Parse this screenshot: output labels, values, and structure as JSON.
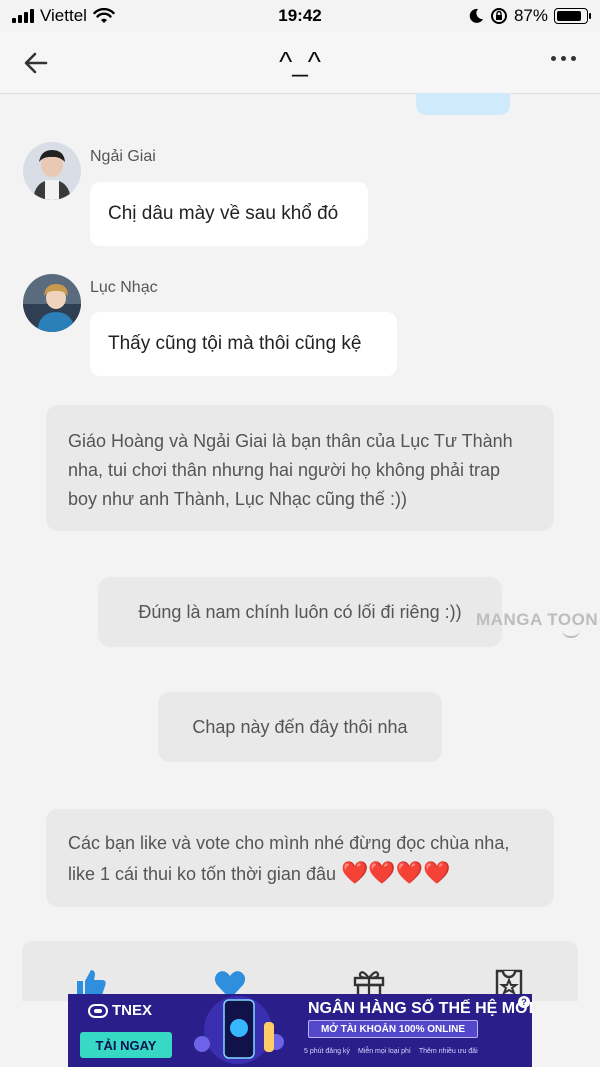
{
  "status_bar": {
    "carrier": "Viettel",
    "time": "19:42",
    "battery": "87%",
    "battery_level": 0.87
  },
  "nav": {
    "title": "^_^",
    "back_icon": "arrow-left-icon",
    "more_icon": "more-dots-icon"
  },
  "messages": [
    {
      "sender": "Ngải Giai",
      "text": "Chị dâu mày về sau khổ đó"
    },
    {
      "sender": "Lục Nhạc",
      "text": "Thấy cũng tội mà thôi cũng kệ"
    }
  ],
  "notes": [
    {
      "text": "Giáo Hoàng và Ngải Giai là bạn thân của Lục Tư Thành nha, tui chơi thân nhưng hai người họ không phải trap boy như anh Thành, Lục Nhạc cũng thế :))"
    },
    {
      "text": "Đúng là nam chính luôn có lối đi riêng :))"
    },
    {
      "text": "Chap này đến đây thôi nha"
    },
    {
      "text": "Các bạn like và vote cho mình nhé đừng đọc chùa nha, like 1 cái thui ko tốn thời gian đâu",
      "hearts": "❤️❤️❤️❤️"
    }
  ],
  "watermark": "MANGA TOON",
  "actions": [
    "like-icon",
    "heart-icon",
    "gift-icon",
    "ticket-star-icon"
  ],
  "ad": {
    "brand": "TNEX",
    "cta": "TẢI NGAY",
    "headline": "NGÂN HÀNG SỐ THẾ HỆ MỚI",
    "subline": "MỞ TÀI KHOẢN 100% ONLINE",
    "features": [
      "5 phút đăng ký",
      "Miễn mọi loại phí",
      "Thêm nhiều ưu đãi"
    ],
    "help": "?"
  },
  "colors": {
    "background": "#f3f3f3",
    "bubble": "#ffffff",
    "note": "#e9e9e9",
    "accent_blue": "#2f8fde",
    "ad_bg": "#2a1f8a"
  }
}
